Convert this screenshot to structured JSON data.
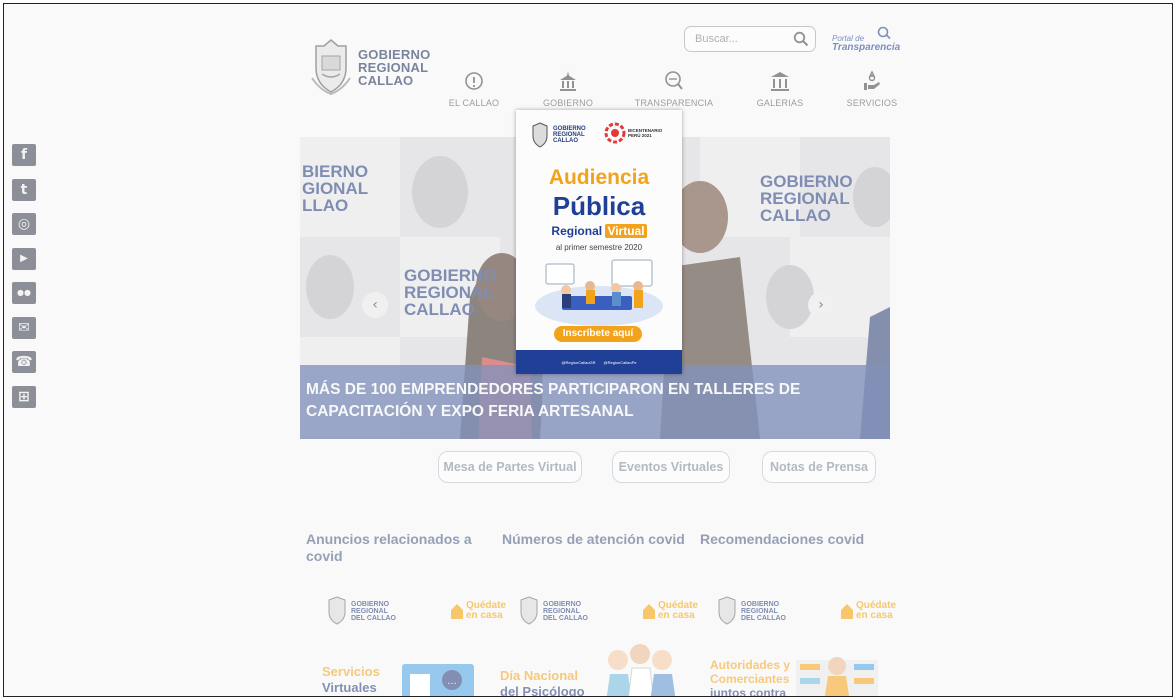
{
  "header": {
    "logo_lines": [
      "GOBIERNO",
      "REGIONAL",
      "CALLAO"
    ],
    "search_placeholder": "Buscar...",
    "portal_line1": "Portal de",
    "portal_line2": "Transparencia",
    "nav": [
      {
        "label": "EL CALLAO",
        "icon": "info-circle-icon"
      },
      {
        "label": "GOBIERNO",
        "icon": "government-building-icon"
      },
      {
        "label": "TRANSPARENCIA",
        "icon": "magnifier-icon"
      },
      {
        "label": "GALERIAS",
        "icon": "columns-building-icon"
      },
      {
        "label": "SERVICIOS",
        "icon": "hand-service-icon"
      }
    ]
  },
  "social": [
    {
      "name": "facebook-icon",
      "glyph": "f"
    },
    {
      "name": "twitter-icon",
      "glyph": "t"
    },
    {
      "name": "instagram-icon",
      "glyph": "◎"
    },
    {
      "name": "youtube-icon",
      "glyph": "▶"
    },
    {
      "name": "flickr-icon",
      "glyph": "●●"
    },
    {
      "name": "mail-icon",
      "glyph": "✉"
    },
    {
      "name": "phone-icon",
      "glyph": "☎"
    },
    {
      "name": "sitemap-icon",
      "glyph": "⊞"
    }
  ],
  "slider": {
    "caption": "MÁS DE 100 EMPRENDEDORES PARTICIPARON EN TALLERES DE CAPACITACIÓN Y EXPO FERIA ARTESANAL",
    "slide_count": 6,
    "active_index": 5,
    "wall_left": "GOBIERNO\nREGIONAL\nCALLAO",
    "wall_right_lines": [
      "GOBIERNO",
      "REGIONAL",
      "CALLAO"
    ],
    "wall_mid_lines": [
      "GOBIERNO",
      "REGIONAL",
      "CALLAO"
    ]
  },
  "quick_buttons": [
    "Mesa de Partes Virtual",
    "Eventos Virtuales",
    "Notas de Prensa"
  ],
  "sections": [
    {
      "title": "Anuncios relacionados a covid"
    },
    {
      "title": "Números de atención covid"
    },
    {
      "title": "Recomendaciones covid"
    }
  ],
  "cards": [
    {
      "logo": [
        "GOBIERNO",
        "REGIONAL",
        "DEL CALLAO"
      ],
      "quedate": [
        "Quédate",
        "en casa"
      ],
      "head": [
        "Servicios",
        "Virtuales"
      ],
      "head_color": "#f3a21c"
    },
    {
      "logo": [
        "GOBIERNO",
        "REGIONAL",
        "DEL CALLAO"
      ],
      "quedate": [
        "Quédate",
        "en casa"
      ],
      "head": [
        "Día Nacional",
        "del Psicólogo"
      ],
      "head_color": "#f3a21c"
    },
    {
      "logo": [
        "GOBIERNO",
        "REGIONAL",
        "DEL CALLAO"
      ],
      "quedate": [
        "Quédate",
        "en casa"
      ],
      "head": [
        "Autoridades y",
        "Comerciantes",
        "juntos contra"
      ],
      "head_color": "#f3a21c"
    }
  ],
  "modal": {
    "gob_lines": [
      "GOBIERNO",
      "REGIONAL",
      "CALLAO"
    ],
    "bic_lines": [
      "BICENTENARIO",
      "PERÚ 2021"
    ],
    "title1": "Audiencia",
    "title2": "Pública",
    "title3_a": "Regional",
    "title3_b": "Virtual",
    "subtitle": "al primer semestre 2020",
    "cta": "Inscríbete aquí",
    "footer_left": "@RegionCallaoGR",
    "footer_right": "@RegionCallaoPe"
  }
}
